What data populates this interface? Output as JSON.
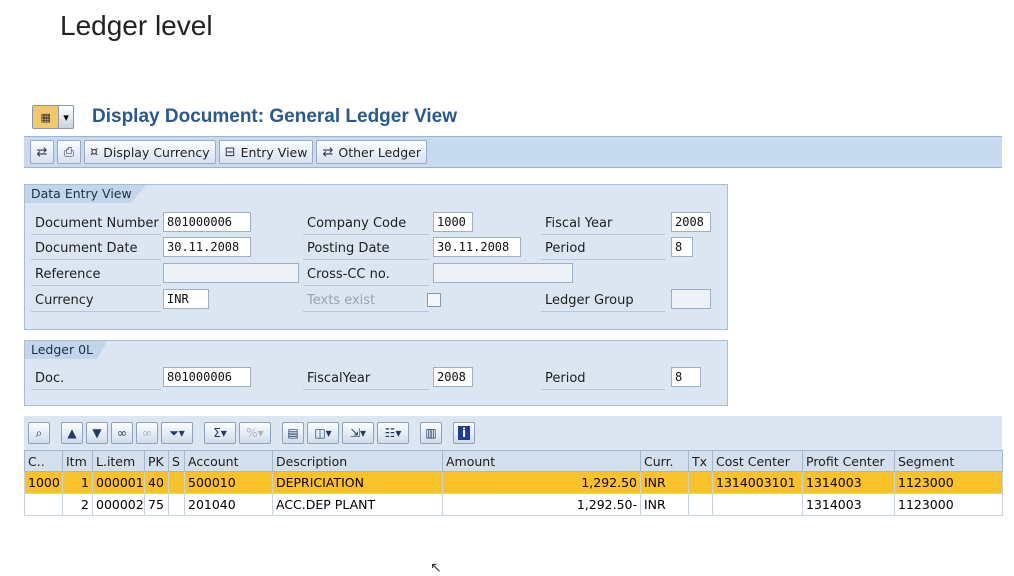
{
  "slide_title": "Ledger level",
  "window": {
    "title": "Display Document: General Ledger View"
  },
  "toolbar": {
    "display_currency": "Display Currency",
    "entry_view": "Entry View",
    "other_ledger": "Other Ledger"
  },
  "data_entry_view": {
    "tab": "Data Entry View",
    "labels": {
      "document_number": "Document Number",
      "document_date": "Document Date",
      "reference": "Reference",
      "currency": "Currency",
      "company_code": "Company Code",
      "posting_date": "Posting Date",
      "cross_cc": "Cross-CC no.",
      "texts_exist": "Texts exist",
      "fiscal_year": "Fiscal Year",
      "period": "Period",
      "ledger_group": "Ledger Group"
    },
    "values": {
      "document_number": "801000006",
      "document_date": "30.11.2008",
      "reference": "",
      "currency": "INR",
      "company_code": "1000",
      "posting_date": "30.11.2008",
      "cross_cc": "",
      "fiscal_year": "2008",
      "period": "8",
      "ledger_group": ""
    }
  },
  "ledger_panel": {
    "tab": "Ledger 0L",
    "labels": {
      "doc": "Doc.",
      "fiscal_year": "FiscalYear",
      "period": "Period"
    },
    "values": {
      "doc": "801000006",
      "fiscal_year": "2008",
      "period": "8"
    }
  },
  "grid": {
    "columns": [
      "C..",
      "Itm",
      "L.item",
      "PK",
      "S",
      "Account",
      "Description",
      "Amount",
      "Curr.",
      "Tx",
      "Cost Center",
      "Profit Center",
      "Segment"
    ],
    "rows": [
      {
        "c": "1000",
        "itm": "1",
        "litem": "000001",
        "pk": "40",
        "s": "",
        "account": "500010",
        "description": "DEPRICIATION",
        "amount": "1,292.50",
        "curr": "INR",
        "tx": "",
        "cost_center": "1314003101",
        "profit_center": "1314003",
        "segment": "1123000"
      },
      {
        "c": "",
        "itm": "2",
        "litem": "000002",
        "pk": "75",
        "s": "",
        "account": "201040",
        "description": "ACC.DEP PLANT",
        "amount": "1,292.50-",
        "curr": "INR",
        "tx": "",
        "cost_center": "",
        "profit_center": "1314003",
        "segment": "1123000"
      }
    ]
  },
  "colors": {
    "selected_row": "#f9c12a",
    "title_blue": "#2a5a8d",
    "panel_bg": "#dbe6f2"
  }
}
